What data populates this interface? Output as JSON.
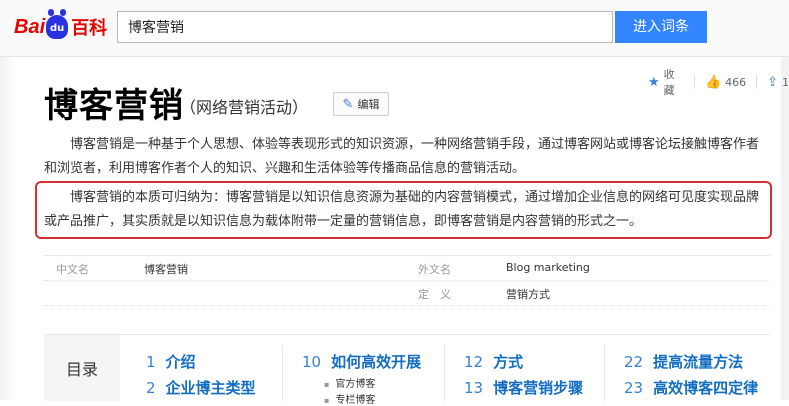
{
  "header": {
    "logo_text_1": "Bai",
    "logo_paw_text": "du",
    "logo_text_2": "百科",
    "search_value": "博客营销",
    "enter_button": "进入词条"
  },
  "tools": {
    "favorite": "收藏",
    "like_count": "466",
    "share_count": "1"
  },
  "entry": {
    "title": "博客营销",
    "subtitle": "（网络营销活动）",
    "edit_label": "编辑",
    "para1": "博客营销是一种基于个人思想、体验等表现形式的知识资源，一种网络营销手段，通过博客网站或博客论坛接触博客作者和浏览者，利用博客作者个人的知识、兴趣和生活体验等传播商品信息的营销活动。",
    "para2": "博客营销的本质可归纳为：博客营销是以知识信息资源为基础的内容营销模式，通过增加企业信息的网络可见度实现品牌或产品推广，其实质就是以知识信息为载体附带一定量的营销信息，即博客营销是内容营销的形式之一。"
  },
  "basic_info": {
    "row1": {
      "name1": "中文名",
      "value1": "博客营销",
      "name2": "外文名",
      "value2": "Blog marketing"
    },
    "row2": {
      "name2": "定　义",
      "value2": "营销方式"
    }
  },
  "toc": {
    "title": "目录",
    "items": [
      {
        "num": "1",
        "label": "介绍"
      },
      {
        "num": "2",
        "label": "企业博主类型"
      },
      {
        "num": "10",
        "label": "如何高效开展"
      },
      {
        "num": "12",
        "label": "方式"
      },
      {
        "num": "13",
        "label": "博客营销步骤"
      },
      {
        "num": "22",
        "label": "提高流量方法"
      },
      {
        "num": "23",
        "label": "高效博客四定律"
      }
    ],
    "subs": [
      "官方博客",
      "专栏博客"
    ]
  }
}
